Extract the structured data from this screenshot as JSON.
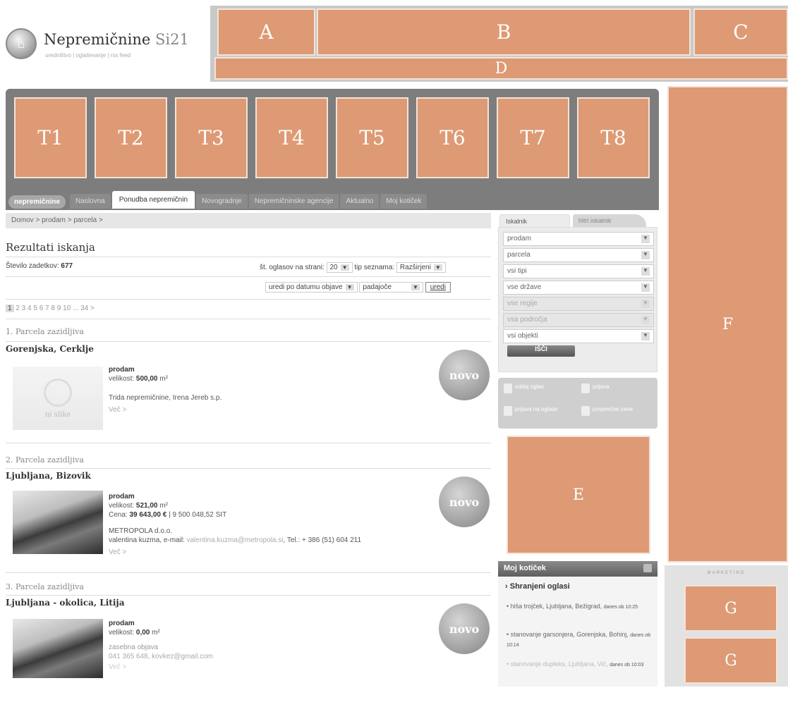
{
  "logo": {
    "name_main": "Nepremičnine",
    "name_suffix": "Si21",
    "subtitle": "uredništvo | oglaševanje | rss feed"
  },
  "ads": {
    "a": "A",
    "b": "B",
    "c": "C",
    "d": "D",
    "e": "E",
    "f": "F",
    "g1": "G",
    "g2": "G",
    "marketing_label": "MARKETING"
  },
  "tiles": [
    "T1",
    "T2",
    "T3",
    "T4",
    "T5",
    "T6",
    "T7",
    "T8"
  ],
  "nav": {
    "brand": "nepremičnine",
    "tabs": [
      "Naslovna",
      "Ponudba nepremičnin",
      "Novogradnje",
      "Nepremičninske agencije",
      "Aktualno",
      "Moj kotiček"
    ],
    "active": "Ponudba nepremičnin"
  },
  "breadcrumb": "Domov  >  prodam  >  parcela  >",
  "results": {
    "title": "Rezultati iskanja",
    "count_label": "Število zadetkov:",
    "count": "677",
    "per_page_label": "št. oglasov na strani:",
    "per_page": "20",
    "list_type_label": "tip seznama:",
    "list_type": "Razširjeni",
    "sort_by": "uredi po datumu objave",
    "sort_dir": "padajoče",
    "sort_button": "uredi"
  },
  "pager": {
    "current": "1",
    "pages": "2  3  4  5  6  7  8  9  10  ...  34  >"
  },
  "listings": [
    {
      "head": "1. Parcela zazidljiva",
      "location": "Gorenjska, Cerklje",
      "type": "prodam",
      "size_label": "velikost:",
      "size": "500,00",
      "unit": "m²",
      "agent": "Trida nepremičnine, Irena Jereb s.p.",
      "more": "Več >",
      "noimg": "ni slike",
      "badge": "novo"
    },
    {
      "head": "2. Parcela zazidljiva",
      "location": "Ljubljana, Bizovik",
      "type": "prodam",
      "size_label": "velikost:",
      "size": "521,00",
      "unit": "m²",
      "price_label": "Cena:",
      "price": "39 643,00 €",
      "price_sit": "| 9 500 048,52 SIT",
      "agent": "METROPOLA d.o.o.",
      "contact_name": "valentina kuzma, e-mail:",
      "contact_email": "valentina.kuzma@metropola.si",
      "contact_tel": ", Tel.: + 386 (51) 604 211",
      "more": "Več >",
      "badge": "novo"
    },
    {
      "head": "3. Parcela zazidljiva",
      "location": "Ljubljana - okolica, Litija",
      "type": "prodam",
      "size_label": "velikost:",
      "size": "0,00",
      "unit": "m²",
      "agent": "zasebna objava",
      "contact": "041 365 648,",
      "contact_email": "kovkez@gmail.com",
      "more": "Več >",
      "badge": "novo"
    }
  ],
  "search": {
    "tab_active": "Iskalnik",
    "tab_other": "hitri iskalnik",
    "fields": [
      "prodam",
      "parcela",
      "vsi tipi",
      "vse države",
      "vse regije",
      "vsa področja",
      "vsi objekti"
    ],
    "button": "IŠČI"
  },
  "actions": {
    "add": "oddaj oglas",
    "login": "prijava",
    "subscribe": "prijava na oglase",
    "avg": "povprečne cene"
  },
  "moj_koticek": {
    "title": "Moj kotiček",
    "saved": "Shranjeni oglasi",
    "items": [
      {
        "text": "hiša trojček, Ljubljana, Bežigrad,",
        "when": "danes ob 10:25"
      },
      {
        "text": "stanovanje garsonjera, Gorenjska, Bohinj,",
        "when": "danes ob 10:14"
      },
      {
        "text": "stanovanje dupleks, Ljubljana, Vič,",
        "when": "danes ob 10:03"
      }
    ]
  }
}
